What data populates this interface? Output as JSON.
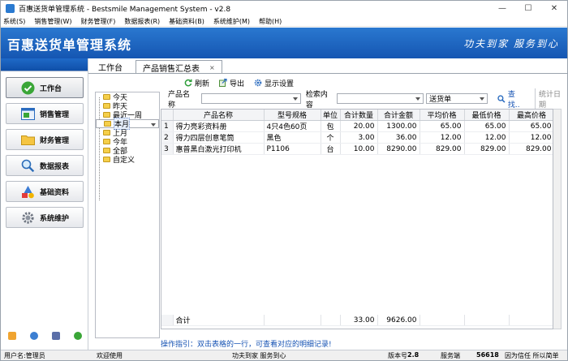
{
  "window": {
    "title": "百惠送货单管理系统 - Bestsmile Management System - v2.8",
    "min": "—",
    "max": "☐",
    "close": "✕"
  },
  "menu": [
    "系统(S)",
    "销售管理(W)",
    "财务管理(F)",
    "数据报表(R)",
    "基础资料(B)",
    "系统维护(M)",
    "帮助(H)"
  ],
  "banner": {
    "title": "百惠送货单管理系统",
    "slogan": "功夫到家 服务到心"
  },
  "nav": [
    {
      "label": "工作台",
      "icon": "check-circle-icon"
    },
    {
      "label": "销售管理",
      "icon": "sales-window-icon"
    },
    {
      "label": "财务管理",
      "icon": "folder-icon"
    },
    {
      "label": "数据报表",
      "icon": "magnifier-icon"
    },
    {
      "label": "基础资料",
      "icon": "shapes-icon"
    },
    {
      "label": "系统维护",
      "icon": "gear-icon"
    }
  ],
  "tabs": {
    "workbench": "工作台",
    "active": "产品销售汇总表",
    "close": "×"
  },
  "tree": [
    "今天",
    "昨天",
    "最近一周",
    "本月",
    "上月",
    "今年",
    "全部",
    "自定义"
  ],
  "toolbar": {
    "refresh": "刷新",
    "export": "导出",
    "display": "显示设置"
  },
  "filter": {
    "product_label": "产品名称",
    "search_label": "检索内容",
    "doc_type": "送货单",
    "search": "查找..",
    "date": "统计日期"
  },
  "table": {
    "headers": [
      "",
      "产品名称",
      "型号规格",
      "单位",
      "合计数量",
      "合计金额",
      "平均价格",
      "最低价格",
      "最高价格"
    ],
    "rows": [
      [
        "1",
        "得力亮彩资料册",
        "4只4色60页",
        "包",
        "20.00",
        "1300.00",
        "65.00",
        "65.00",
        "65.00"
      ],
      [
        "2",
        "得力四层创意笔筒",
        "黑色",
        "个",
        "3.00",
        "36.00",
        "12.00",
        "12.00",
        "12.00"
      ],
      [
        "3",
        "惠普黑白激光打印机",
        "P1106",
        "台",
        "10.00",
        "8290.00",
        "829.00",
        "829.00",
        "829.00"
      ]
    ],
    "total": {
      "label": "合计",
      "qty": "33.00",
      "amount": "9626.00"
    }
  },
  "hint": "操作指引：双击表格的一行，可查看对应的明细记录!",
  "status": {
    "user": "用户名:管理员",
    "welcome": "欢迎使用",
    "motto": "功夫到家 服务到心",
    "version_label": "版本号",
    "version": "2.8",
    "server": "服务端",
    "code": "56618",
    "trust": "因为信任 所以简单"
  },
  "colors": {
    "banner": "#1f66c4",
    "accent": "#1552b3"
  }
}
